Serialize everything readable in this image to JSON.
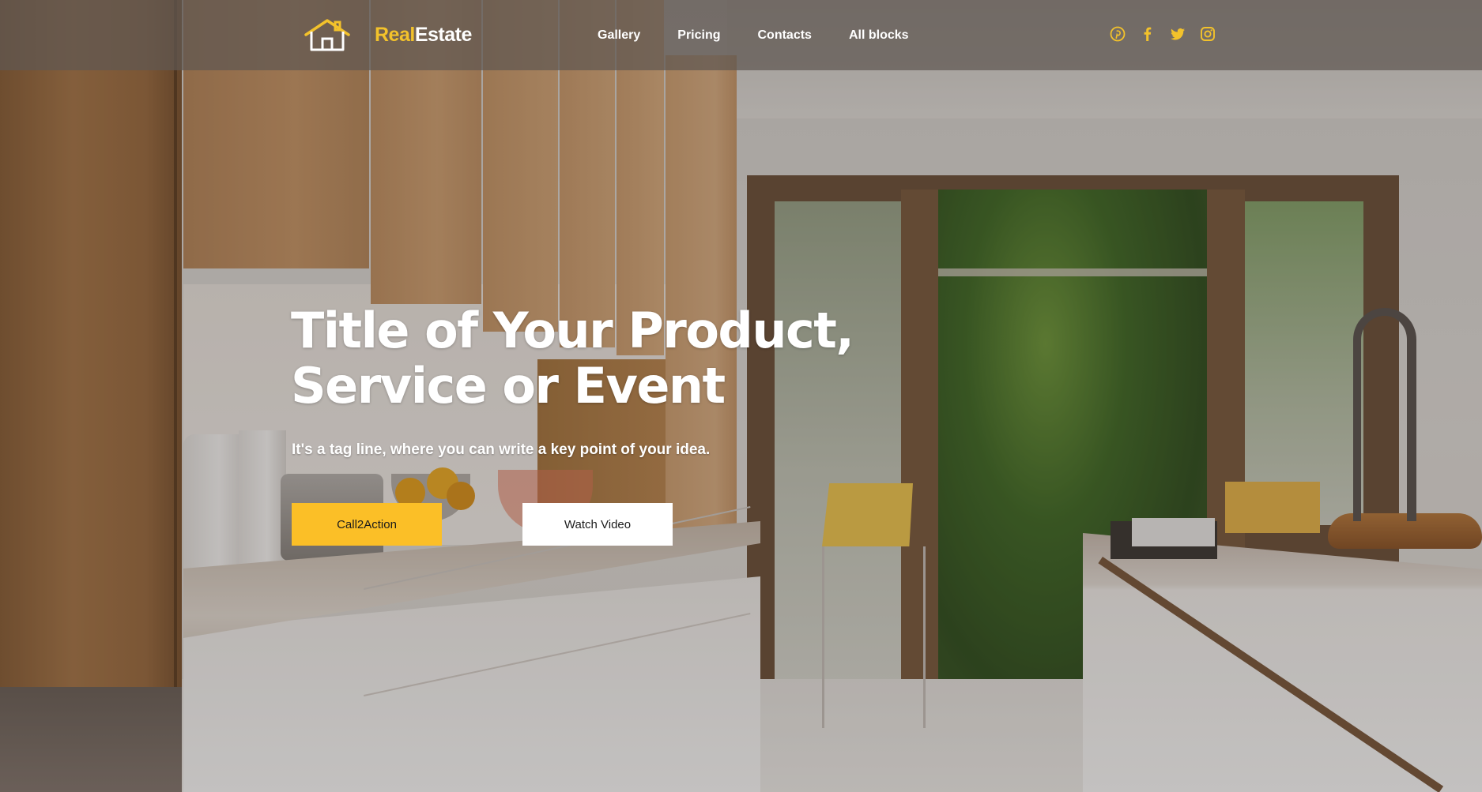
{
  "colors": {
    "accent": "#fbbf27",
    "brand_accent": "#f3c22b",
    "header_bg": "rgba(95,88,82,0.72)",
    "text_light": "#ffffff"
  },
  "header": {
    "logo": {
      "icon": "house-icon",
      "brand_accent": "Real",
      "brand_rest": "Estate"
    },
    "nav": [
      {
        "label": "Gallery"
      },
      {
        "label": "Pricing"
      },
      {
        "label": "Contacts"
      },
      {
        "label": "All blocks"
      }
    ],
    "social": [
      {
        "icon": "pinterest-icon"
      },
      {
        "icon": "facebook-icon"
      },
      {
        "icon": "twitter-icon"
      },
      {
        "icon": "instagram-icon"
      }
    ]
  },
  "hero": {
    "title_line1": "Title of Your Product,",
    "title_line2": "Service or Event",
    "tagline": "It's a tag line, where you can write a key point of your idea.",
    "primary_button": "Call2Action",
    "secondary_button": "Watch Video",
    "background": "kitchen-photo"
  }
}
